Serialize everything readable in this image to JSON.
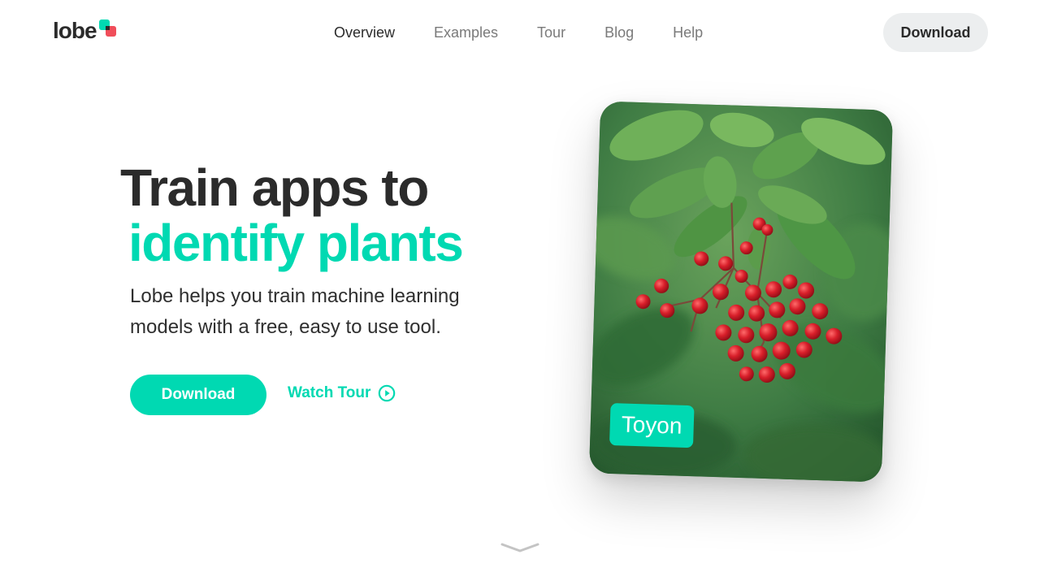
{
  "brand": {
    "logo_text": "lobe",
    "accent": "#00d9b2",
    "accent_secondary": "#f04e5a"
  },
  "nav": {
    "items": [
      {
        "label": "Overview",
        "active": true
      },
      {
        "label": "Examples",
        "active": false
      },
      {
        "label": "Tour",
        "active": false
      },
      {
        "label": "Blog",
        "active": false
      },
      {
        "label": "Help",
        "active": false
      }
    ]
  },
  "header": {
    "download_label": "Download"
  },
  "hero": {
    "headline_line1": "Train apps to",
    "headline_line2": "identify plants",
    "subtitle": "Lobe helps you train machine learning models with a free, easy to use tool.",
    "primary_cta": "Download",
    "secondary_cta": "Watch Tour"
  },
  "card": {
    "prediction_label": "Toyon",
    "image_subject": "red toyon berries on green leaves"
  },
  "icons": {
    "play": "play-circle-icon",
    "scroll": "chevron-down-icon"
  }
}
